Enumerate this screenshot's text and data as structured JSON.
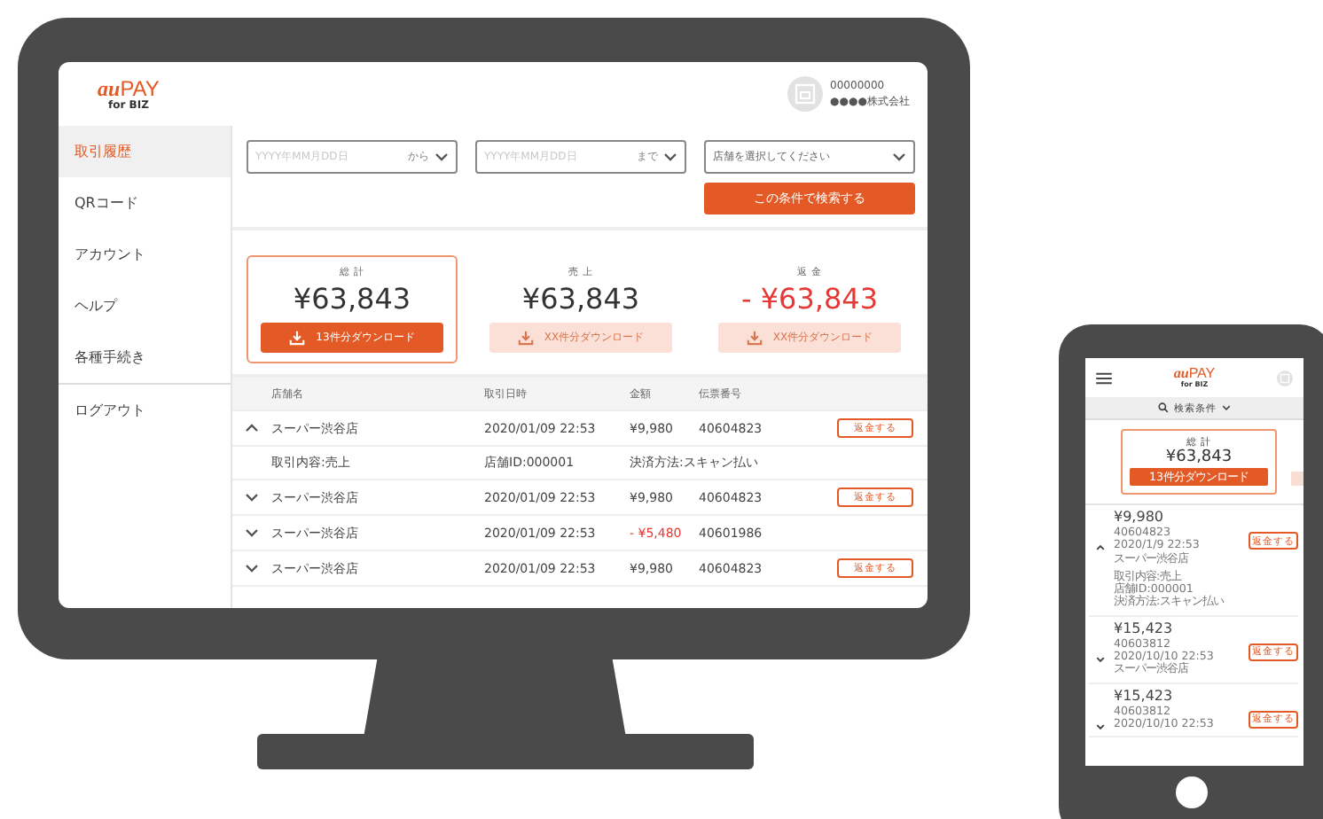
{
  "desktop": {
    "logo": {
      "brand_a": "au",
      "brand_b": "PAY",
      "sub": "for BIZ"
    },
    "account": {
      "id": "00000000",
      "company": "●●●●株式会社"
    },
    "sidebar": {
      "items": [
        {
          "label": "取引履歴",
          "selected": true
        },
        {
          "label": "QRコード",
          "selected": false
        },
        {
          "label": "アカウント",
          "selected": false
        },
        {
          "label": "ヘルプ",
          "selected": false
        },
        {
          "label": "各種手続き",
          "selected": false
        }
      ],
      "logout": "ログアウト"
    },
    "filters": {
      "from": {
        "placeholder": "YYYY年MM月DD日",
        "suffix": "から"
      },
      "to": {
        "placeholder": "YYYY年MM月DD日",
        "suffix": "まで"
      },
      "shop": {
        "placeholder": "店舗を選択してください"
      },
      "search_button": "この条件で検索する"
    },
    "summary": [
      {
        "label": "総 計",
        "amount": "¥63,843",
        "negative": false,
        "selected": true,
        "download": "13件分ダウンロード",
        "disabled": false
      },
      {
        "label": "売 上",
        "amount": "¥63,843",
        "negative": false,
        "selected": false,
        "download": "XX件分ダウンロード",
        "disabled": true
      },
      {
        "label": "返 金",
        "amount": "- ¥63,843",
        "negative": true,
        "selected": false,
        "download": "XX件分ダウンロード",
        "disabled": true
      }
    ],
    "table": {
      "columns": [
        "店舗名",
        "取引日時",
        "金額",
        "伝票番号"
      ],
      "rows": [
        {
          "expanded": true,
          "shop": "スーパー渋谷店",
          "datetime": "2020/01/09 22:53",
          "amount": "¥9,980",
          "negative": false,
          "slip": "40604823",
          "refund": "返金する",
          "details": [
            "取引内容:売上",
            "店舗ID:000001",
            "決済方法:スキャン払い"
          ]
        },
        {
          "expanded": false,
          "shop": "スーパー渋谷店",
          "datetime": "2020/01/09 22:53",
          "amount": "¥9,980",
          "negative": false,
          "slip": "40604823",
          "refund": "返金する"
        },
        {
          "expanded": false,
          "shop": "スーパー渋谷店",
          "datetime": "2020/01/09 22:53",
          "amount": "- ¥5,480",
          "negative": true,
          "slip": "40601986"
        },
        {
          "expanded": false,
          "shop": "スーパー渋谷店",
          "datetime": "2020/01/09 22:53",
          "amount": "¥9,980",
          "negative": false,
          "slip": "40604823",
          "refund": "返金する"
        }
      ]
    }
  },
  "mobile": {
    "logo": {
      "brand_a": "au",
      "brand_b": "PAY",
      "sub": "for BIZ"
    },
    "search": "検索条件",
    "summary": {
      "label": "総 計",
      "amount": "¥63,843",
      "download": "13件分ダウンロード"
    },
    "items": [
      {
        "expanded": true,
        "amount": "¥9,980",
        "slip": "40604823",
        "datetime": "2020/1/9 22:53",
        "shop": "スーパー渋谷店",
        "details": [
          "取引内容:売上",
          "店舗ID:000001",
          "決済方法:スキャン払い"
        ],
        "refund": "返金する"
      },
      {
        "expanded": false,
        "amount": "¥15,423",
        "slip": "40603812",
        "datetime": "2020/10/10 22:53",
        "shop": "スーパー渋谷店",
        "refund": "返金する"
      },
      {
        "expanded": false,
        "amount": "¥15,423",
        "slip": "40603812",
        "datetime": "2020/10/10 22:53",
        "refund": "返金する"
      }
    ]
  }
}
